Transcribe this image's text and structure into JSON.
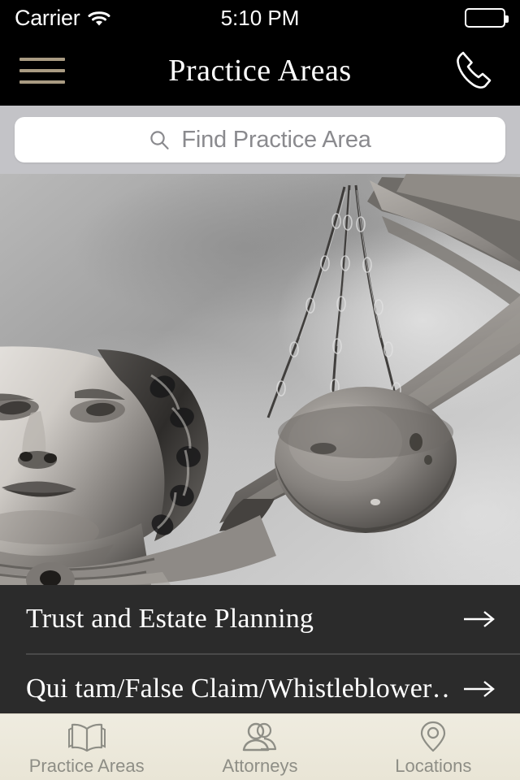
{
  "status_bar": {
    "carrier": "Carrier",
    "wifi_icon": "wifi-icon",
    "time": "5:10 PM",
    "battery_icon": "battery-full-icon"
  },
  "nav_bar": {
    "menu_icon": "hamburger-menu-icon",
    "title": "Practice Areas",
    "phone_icon": "phone-icon",
    "menu_color": "#a99b82",
    "background": "#000000"
  },
  "search": {
    "icon": "search-icon",
    "placeholder": "Find Practice Area",
    "value": "",
    "bar_background": "#c3c3c7",
    "field_background": "#ffffff"
  },
  "hero": {
    "alt": "Black and white photograph of Lady Justice statue holding scales",
    "image_name": "lady-justice-statue-photo"
  },
  "list": {
    "background": "#2b2b2b",
    "rows": [
      {
        "label": "Trust and Estate Planning",
        "arrow_icon": "arrow-right-icon"
      },
      {
        "label": "Qui tam/False Claim/Whistleblower…",
        "arrow_icon": "arrow-right-icon"
      }
    ]
  },
  "tab_bar": {
    "background": "#ece8da",
    "inactive_color": "#8e8e86",
    "tabs": [
      {
        "label": "Practice Areas",
        "icon": "open-book-icon",
        "active": true
      },
      {
        "label": "Attorneys",
        "icon": "people-icon",
        "active": false
      },
      {
        "label": "Locations",
        "icon": "map-pin-icon",
        "active": false
      }
    ]
  }
}
